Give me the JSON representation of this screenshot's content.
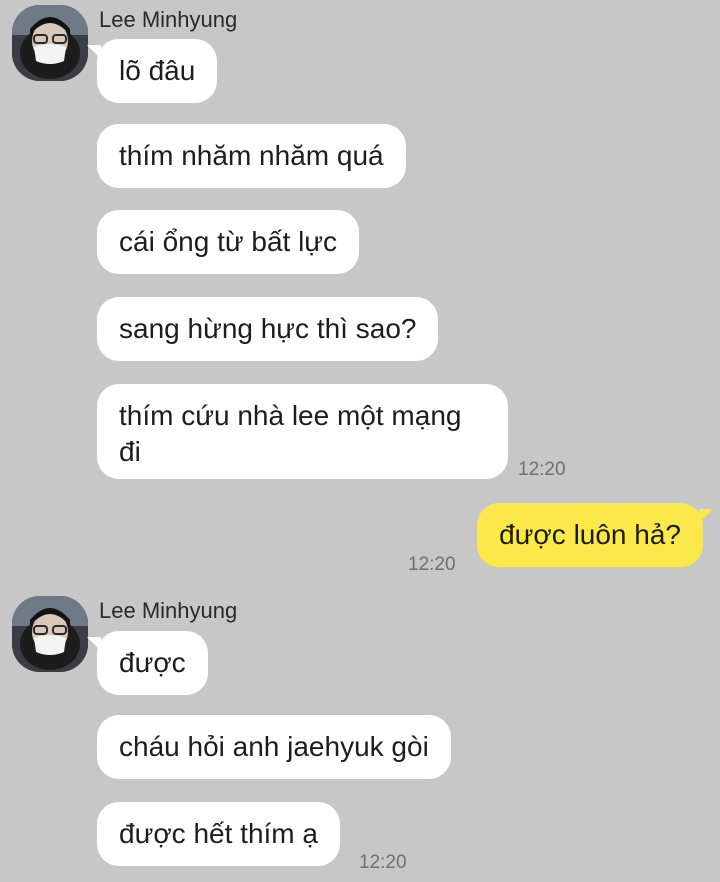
{
  "groups": [
    {
      "sender": "Lee Minhyung",
      "messages": [
        {
          "text": "lõ đâu"
        },
        {
          "text": "thím nhăm nhăm quá"
        },
        {
          "text": "cái ổng từ bất lực"
        },
        {
          "text": "sang hừng hực thì sao?"
        },
        {
          "text": "thím cứu nhà lee một mạng đi",
          "time": "12:20"
        }
      ]
    },
    {
      "sender": "me",
      "messages": [
        {
          "text": "được luôn hả?",
          "time": "12:20"
        }
      ]
    },
    {
      "sender": "Lee Minhyung",
      "messages": [
        {
          "text": "được"
        },
        {
          "text": "cháu hỏi anh jaehyuk gòi"
        },
        {
          "text": "được hết thím ạ",
          "time": "12:20"
        }
      ]
    }
  ],
  "colors": {
    "background": "#c7c7c7",
    "incoming_bubble": "#ffffff",
    "outgoing_bubble": "#fbe84a"
  },
  "icons": [
    "avatar-icon"
  ]
}
